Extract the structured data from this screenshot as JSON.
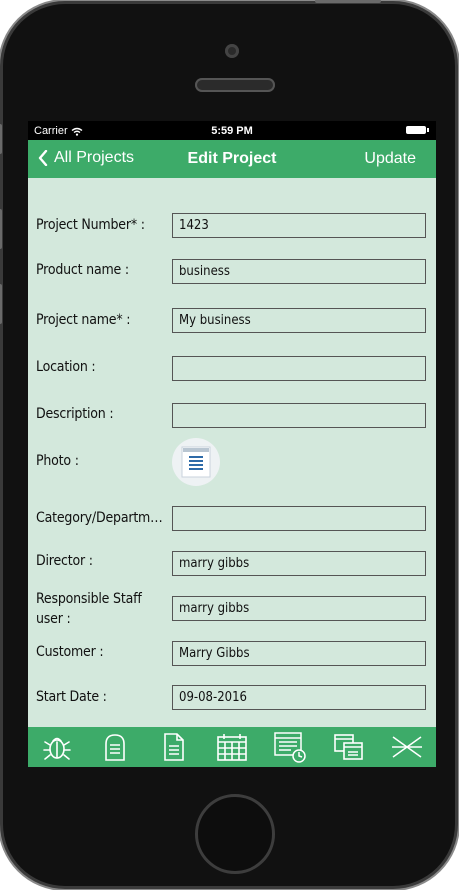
{
  "status_bar": {
    "carrier": "Carrier",
    "time": "5:59 PM"
  },
  "nav": {
    "back_label": "All Projects",
    "title": "Edit Project",
    "update_label": "Update"
  },
  "form": {
    "fields": [
      {
        "label": "Project Number* :",
        "value": "1423"
      },
      {
        "label": "Product name :",
        "value": "business"
      },
      {
        "label": "Project name* :",
        "value": "My business"
      },
      {
        "label": "Location :",
        "value": ""
      },
      {
        "label": "Description :",
        "value": ""
      },
      {
        "label": "Photo :"
      },
      {
        "label": "Category/Departm…",
        "value": ""
      },
      {
        "label": "Director :",
        "value": "marry gibbs"
      },
      {
        "label": "Responsible Staff user :",
        "value": "marry gibbs"
      },
      {
        "label": "Customer :",
        "value": "Marry Gibbs"
      },
      {
        "label": "Start Date :",
        "value": "09-08-2016"
      }
    ]
  },
  "tabs": [
    {
      "icon": "bug-icon"
    },
    {
      "icon": "tombstone-icon"
    },
    {
      "icon": "document-icon"
    },
    {
      "icon": "calendar-icon"
    },
    {
      "icon": "timesheet-icon"
    },
    {
      "icon": "copy-icon"
    },
    {
      "icon": "close-x-icon"
    }
  ],
  "colors": {
    "accent": "#3dab69",
    "background": "#d3e8dc"
  }
}
